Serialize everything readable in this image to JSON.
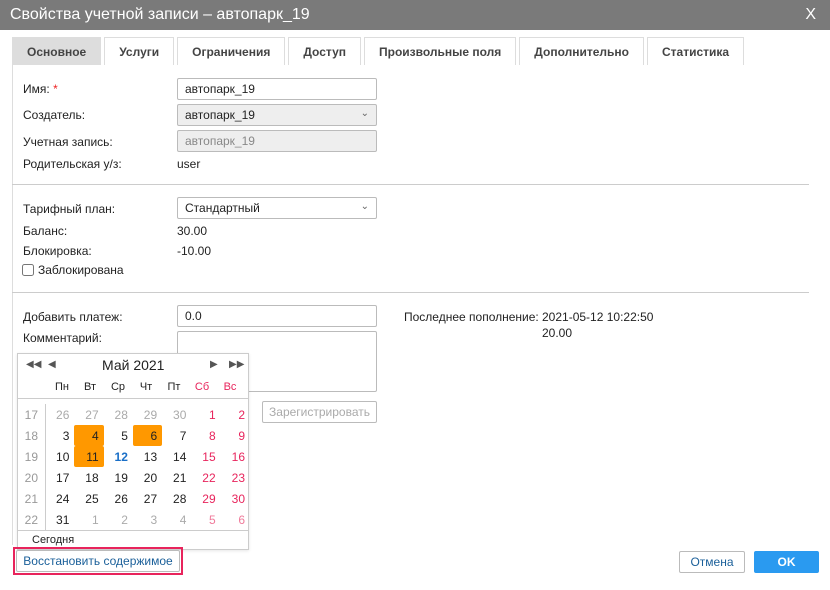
{
  "title": "Свойства учетной записи – автопарк_19",
  "close": "X",
  "tabs": [
    "Основное",
    "Услуги",
    "Ограничения",
    "Доступ",
    "Произвольные поля",
    "Дополнительно",
    "Статистика"
  ],
  "form": {
    "name_label": "Имя:",
    "name_required": "*",
    "name_value": "автопарк_19",
    "creator_label": "Создатель:",
    "creator_value": "автопарк_19",
    "account_label": "Учетная запись:",
    "account_value": "автопарк_19",
    "parent_label": "Родительская у/з:",
    "parent_value": "user",
    "tariff_label": "Тарифный план:",
    "tariff_value": "Стандартный",
    "balance_label": "Баланс:",
    "balance_value": "30.00",
    "block_label": "Блокировка:",
    "block_value": "-10.00",
    "blocked_checkbox": "Заблокирована",
    "payment_label": "Добавить платеж:",
    "payment_value": "0.0",
    "comment_label": "Комментарий:",
    "last_label": "Последнее пополнение:",
    "last_date": "2021-05-12 10:22:50",
    "last_amount": "20.00",
    "register": "Зарегистрировать"
  },
  "calendar": {
    "month": "Май 2021",
    "weekdays": [
      "Пн",
      "Вт",
      "Ср",
      "Чт",
      "Пт",
      "Сб",
      "Вс"
    ],
    "weeks": [
      {
        "n": "17",
        "d": [
          "26",
          "27",
          "28",
          "29",
          "30",
          "1",
          "2"
        ]
      },
      {
        "n": "18",
        "d": [
          "3",
          "4",
          "5",
          "6",
          "7",
          "8",
          "9"
        ]
      },
      {
        "n": "19",
        "d": [
          "10",
          "11",
          "12",
          "13",
          "14",
          "15",
          "16"
        ]
      },
      {
        "n": "20",
        "d": [
          "17",
          "18",
          "19",
          "20",
          "21",
          "22",
          "23"
        ]
      },
      {
        "n": "21",
        "d": [
          "24",
          "25",
          "26",
          "27",
          "28",
          "29",
          "30"
        ]
      },
      {
        "n": "22",
        "d": [
          "31",
          "1",
          "2",
          "3",
          "4",
          "5",
          "6"
        ]
      }
    ],
    "highlighted": [
      "4",
      "11",
      "6"
    ],
    "today": "12",
    "today_button": "Сегодня"
  },
  "buttons": {
    "restore": "Восстановить содержимое",
    "cancel": "Отмена",
    "ok": "OK"
  },
  "colors": {
    "accent": "#2a9af0",
    "highlight": "#ff9800",
    "weekend": "#e8245c"
  }
}
